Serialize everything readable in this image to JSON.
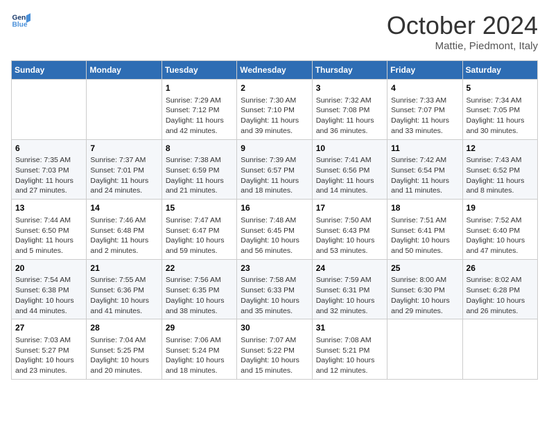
{
  "header": {
    "logo_line1": "General",
    "logo_line2": "Blue",
    "month_title": "October 2024",
    "location": "Mattie, Piedmont, Italy"
  },
  "weekdays": [
    "Sunday",
    "Monday",
    "Tuesday",
    "Wednesday",
    "Thursday",
    "Friday",
    "Saturday"
  ],
  "weeks": [
    [
      {
        "day": "",
        "sunrise": "",
        "sunset": "",
        "daylight": ""
      },
      {
        "day": "",
        "sunrise": "",
        "sunset": "",
        "daylight": ""
      },
      {
        "day": "1",
        "sunrise": "Sunrise: 7:29 AM",
        "sunset": "Sunset: 7:12 PM",
        "daylight": "Daylight: 11 hours and 42 minutes."
      },
      {
        "day": "2",
        "sunrise": "Sunrise: 7:30 AM",
        "sunset": "Sunset: 7:10 PM",
        "daylight": "Daylight: 11 hours and 39 minutes."
      },
      {
        "day": "3",
        "sunrise": "Sunrise: 7:32 AM",
        "sunset": "Sunset: 7:08 PM",
        "daylight": "Daylight: 11 hours and 36 minutes."
      },
      {
        "day": "4",
        "sunrise": "Sunrise: 7:33 AM",
        "sunset": "Sunset: 7:07 PM",
        "daylight": "Daylight: 11 hours and 33 minutes."
      },
      {
        "day": "5",
        "sunrise": "Sunrise: 7:34 AM",
        "sunset": "Sunset: 7:05 PM",
        "daylight": "Daylight: 11 hours and 30 minutes."
      }
    ],
    [
      {
        "day": "6",
        "sunrise": "Sunrise: 7:35 AM",
        "sunset": "Sunset: 7:03 PM",
        "daylight": "Daylight: 11 hours and 27 minutes."
      },
      {
        "day": "7",
        "sunrise": "Sunrise: 7:37 AM",
        "sunset": "Sunset: 7:01 PM",
        "daylight": "Daylight: 11 hours and 24 minutes."
      },
      {
        "day": "8",
        "sunrise": "Sunrise: 7:38 AM",
        "sunset": "Sunset: 6:59 PM",
        "daylight": "Daylight: 11 hours and 21 minutes."
      },
      {
        "day": "9",
        "sunrise": "Sunrise: 7:39 AM",
        "sunset": "Sunset: 6:57 PM",
        "daylight": "Daylight: 11 hours and 18 minutes."
      },
      {
        "day": "10",
        "sunrise": "Sunrise: 7:41 AM",
        "sunset": "Sunset: 6:56 PM",
        "daylight": "Daylight: 11 hours and 14 minutes."
      },
      {
        "day": "11",
        "sunrise": "Sunrise: 7:42 AM",
        "sunset": "Sunset: 6:54 PM",
        "daylight": "Daylight: 11 hours and 11 minutes."
      },
      {
        "day": "12",
        "sunrise": "Sunrise: 7:43 AM",
        "sunset": "Sunset: 6:52 PM",
        "daylight": "Daylight: 11 hours and 8 minutes."
      }
    ],
    [
      {
        "day": "13",
        "sunrise": "Sunrise: 7:44 AM",
        "sunset": "Sunset: 6:50 PM",
        "daylight": "Daylight: 11 hours and 5 minutes."
      },
      {
        "day": "14",
        "sunrise": "Sunrise: 7:46 AM",
        "sunset": "Sunset: 6:48 PM",
        "daylight": "Daylight: 11 hours and 2 minutes."
      },
      {
        "day": "15",
        "sunrise": "Sunrise: 7:47 AM",
        "sunset": "Sunset: 6:47 PM",
        "daylight": "Daylight: 10 hours and 59 minutes."
      },
      {
        "day": "16",
        "sunrise": "Sunrise: 7:48 AM",
        "sunset": "Sunset: 6:45 PM",
        "daylight": "Daylight: 10 hours and 56 minutes."
      },
      {
        "day": "17",
        "sunrise": "Sunrise: 7:50 AM",
        "sunset": "Sunset: 6:43 PM",
        "daylight": "Daylight: 10 hours and 53 minutes."
      },
      {
        "day": "18",
        "sunrise": "Sunrise: 7:51 AM",
        "sunset": "Sunset: 6:41 PM",
        "daylight": "Daylight: 10 hours and 50 minutes."
      },
      {
        "day": "19",
        "sunrise": "Sunrise: 7:52 AM",
        "sunset": "Sunset: 6:40 PM",
        "daylight": "Daylight: 10 hours and 47 minutes."
      }
    ],
    [
      {
        "day": "20",
        "sunrise": "Sunrise: 7:54 AM",
        "sunset": "Sunset: 6:38 PM",
        "daylight": "Daylight: 10 hours and 44 minutes."
      },
      {
        "day": "21",
        "sunrise": "Sunrise: 7:55 AM",
        "sunset": "Sunset: 6:36 PM",
        "daylight": "Daylight: 10 hours and 41 minutes."
      },
      {
        "day": "22",
        "sunrise": "Sunrise: 7:56 AM",
        "sunset": "Sunset: 6:35 PM",
        "daylight": "Daylight: 10 hours and 38 minutes."
      },
      {
        "day": "23",
        "sunrise": "Sunrise: 7:58 AM",
        "sunset": "Sunset: 6:33 PM",
        "daylight": "Daylight: 10 hours and 35 minutes."
      },
      {
        "day": "24",
        "sunrise": "Sunrise: 7:59 AM",
        "sunset": "Sunset: 6:31 PM",
        "daylight": "Daylight: 10 hours and 32 minutes."
      },
      {
        "day": "25",
        "sunrise": "Sunrise: 8:00 AM",
        "sunset": "Sunset: 6:30 PM",
        "daylight": "Daylight: 10 hours and 29 minutes."
      },
      {
        "day": "26",
        "sunrise": "Sunrise: 8:02 AM",
        "sunset": "Sunset: 6:28 PM",
        "daylight": "Daylight: 10 hours and 26 minutes."
      }
    ],
    [
      {
        "day": "27",
        "sunrise": "Sunrise: 7:03 AM",
        "sunset": "Sunset: 5:27 PM",
        "daylight": "Daylight: 10 hours and 23 minutes."
      },
      {
        "day": "28",
        "sunrise": "Sunrise: 7:04 AM",
        "sunset": "Sunset: 5:25 PM",
        "daylight": "Daylight: 10 hours and 20 minutes."
      },
      {
        "day": "29",
        "sunrise": "Sunrise: 7:06 AM",
        "sunset": "Sunset: 5:24 PM",
        "daylight": "Daylight: 10 hours and 18 minutes."
      },
      {
        "day": "30",
        "sunrise": "Sunrise: 7:07 AM",
        "sunset": "Sunset: 5:22 PM",
        "daylight": "Daylight: 10 hours and 15 minutes."
      },
      {
        "day": "31",
        "sunrise": "Sunrise: 7:08 AM",
        "sunset": "Sunset: 5:21 PM",
        "daylight": "Daylight: 10 hours and 12 minutes."
      },
      {
        "day": "",
        "sunrise": "",
        "sunset": "",
        "daylight": ""
      },
      {
        "day": "",
        "sunrise": "",
        "sunset": "",
        "daylight": ""
      }
    ]
  ]
}
